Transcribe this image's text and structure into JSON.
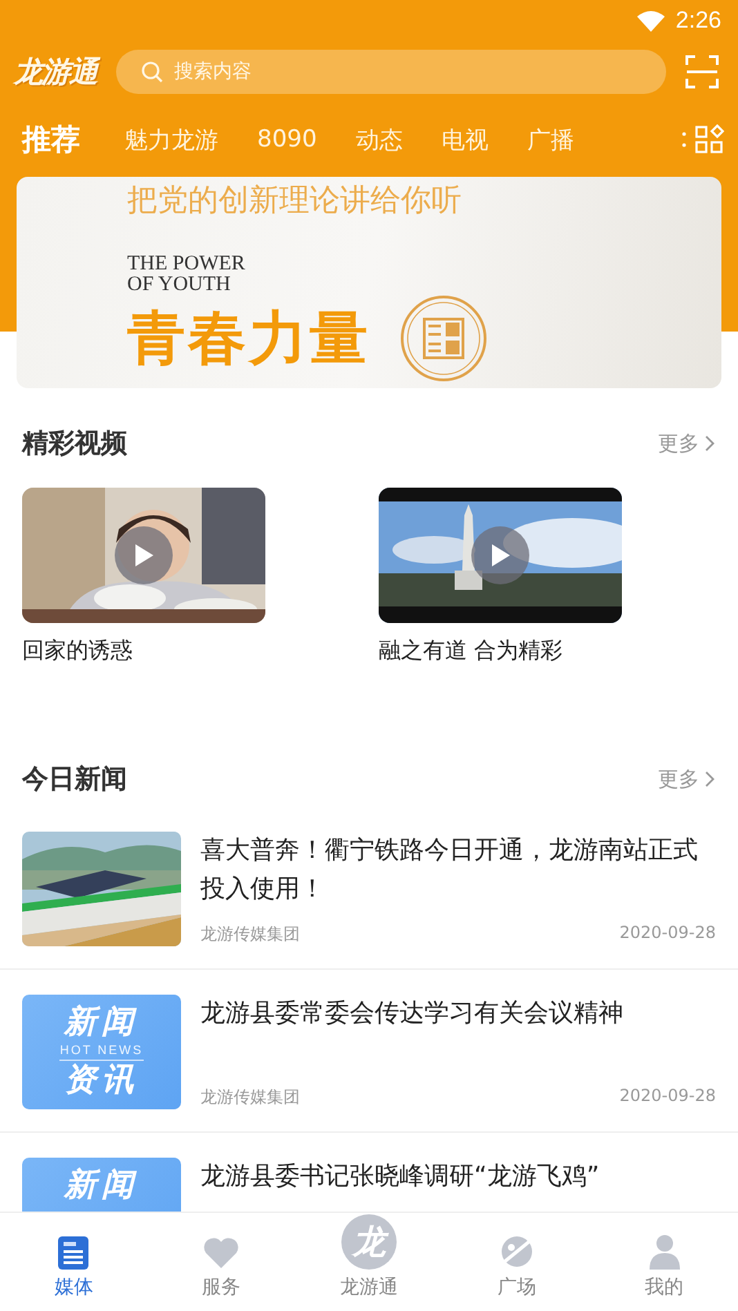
{
  "status_bar": {
    "time": "2:26"
  },
  "header": {
    "logo": "龙游通",
    "search": {
      "placeholder": "搜索内容"
    }
  },
  "tabs": [
    {
      "label": "推荐",
      "selected": true
    },
    {
      "label": "魅力龙游",
      "selected": false
    },
    {
      "label": "8090",
      "selected": false
    },
    {
      "label": "动态",
      "selected": false
    },
    {
      "label": "电视",
      "selected": false
    },
    {
      "label": "广播",
      "selected": false
    }
  ],
  "banner": {
    "headline": "把党的创新理论讲给你听",
    "subtitle_lines": [
      "THE POWER",
      "OF YOUTH"
    ],
    "title": "青春力量"
  },
  "videos": {
    "title": "精彩视频",
    "more": "更多",
    "items": [
      {
        "title": "回家的诱惑"
      },
      {
        "title": "融之有道 合为精彩"
      }
    ]
  },
  "news": {
    "title": "今日新闻",
    "more": "更多",
    "items": [
      {
        "title": "喜大普奔！衢宁铁路今日开通，龙游南站正式投入使用！",
        "source": "龙游传媒集团",
        "date": "2020-09-28"
      },
      {
        "thumb": {
          "kind": "badge",
          "lines": [
            "新闻",
            "HOT NEWS",
            "资讯"
          ]
        },
        "title": "龙游县委常委会传达学习有关会议精神",
        "source": "龙游传媒集团",
        "date": "2020-09-28"
      },
      {
        "thumb": {
          "kind": "badge",
          "lines": [
            "新闻"
          ]
        },
        "title": "龙游县委书记张晓峰调研“龙游飞鸡”"
      }
    ]
  },
  "nav": [
    {
      "kind": "tab",
      "label": "媒体",
      "selected": true
    },
    {
      "kind": "tab",
      "label": "服务",
      "selected": false
    },
    {
      "kind": "center",
      "glyph": "龙",
      "label": "龙游通",
      "selected": false
    },
    {
      "kind": "tab",
      "label": "广场",
      "selected": false
    },
    {
      "kind": "tab",
      "label": "我的",
      "selected": false
    }
  ]
}
